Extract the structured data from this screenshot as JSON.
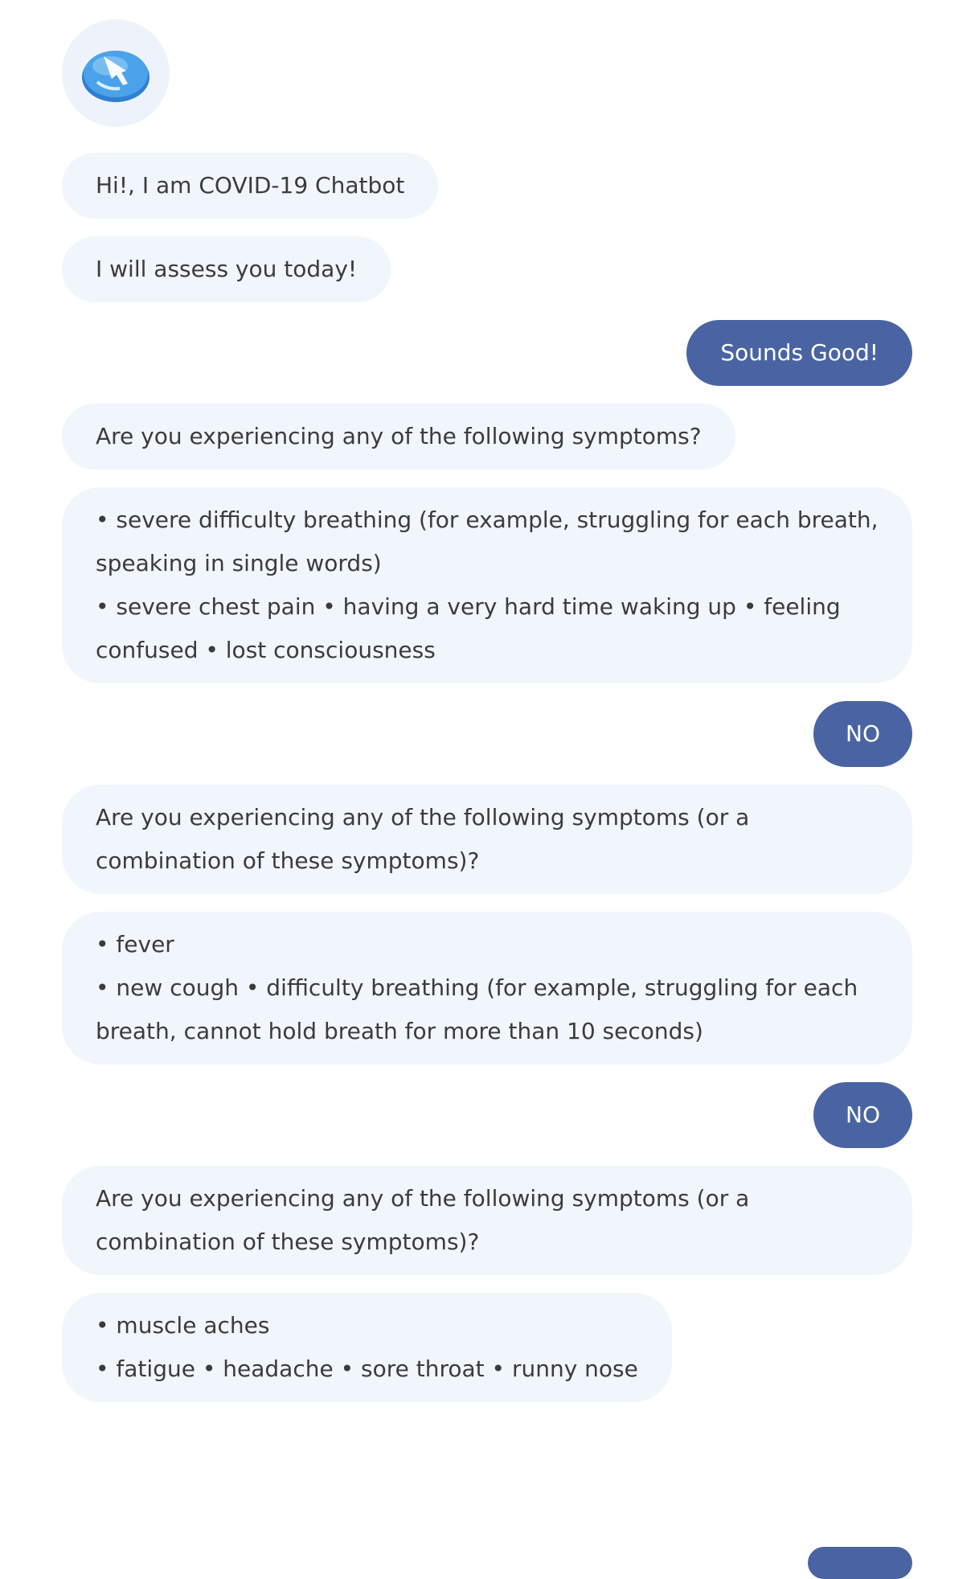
{
  "bot": {
    "avatar_icon": "chatbot-logo-icon",
    "accent_color": "#3b8fdc"
  },
  "colors": {
    "bot_bubble": "#f1f5fc",
    "user_bubble": "#4a64a3",
    "user_text": "#ffffff",
    "bot_text": "#3b3b3b"
  },
  "messages": [
    {
      "from": "bot",
      "text": "Hi!, I am COVID-19 Chatbot"
    },
    {
      "from": "bot",
      "text": "I will assess you today!"
    },
    {
      "from": "user",
      "text": "Sounds Good!"
    },
    {
      "from": "bot",
      "text": "Are you experiencing any of the following symptoms?"
    },
    {
      "from": "bot",
      "text": "• severe difficulty breathing (for example, struggling for each breath, speaking in single words)\n• severe chest pain • having a very hard time waking up • feeling confused • lost consciousness"
    },
    {
      "from": "user",
      "text": "NO"
    },
    {
      "from": "bot",
      "text": "Are you experiencing any of the following symptoms (or a combination of these symptoms)?"
    },
    {
      "from": "bot",
      "text": "• fever\n• new cough • difficulty breathing (for example, struggling for each breath, cannot hold breath for more than 10 seconds)"
    },
    {
      "from": "user",
      "text": "NO"
    },
    {
      "from": "bot",
      "text": "Are you experiencing any of the following symptoms (or a combination of these symptoms)?"
    },
    {
      "from": "bot",
      "text": "• muscle aches\n• fatigue • headache • sore throat • runny nose"
    }
  ]
}
